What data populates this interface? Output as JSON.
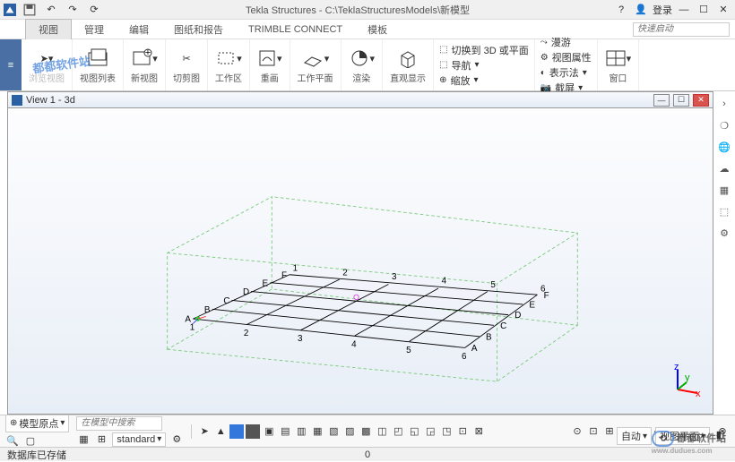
{
  "titlebar": {
    "appTitle": "Tekla Structures - C:\\TeklaStructuresModels\\新模型",
    "login": "登录"
  },
  "menu": {
    "tabs": [
      "视图",
      "管理",
      "编辑",
      "图纸和报告",
      "TRIMBLE CONNECT",
      "模板"
    ],
    "activeIndex": 0,
    "searchPlaceholder": "快速启动"
  },
  "ribbon": {
    "groups": [
      {
        "label": "浏览视图",
        "disabled": true
      },
      {
        "label": "视图列表"
      },
      {
        "label": "新视图"
      },
      {
        "label": "切剪图"
      },
      {
        "label": "工作区"
      },
      {
        "label": "重画"
      },
      {
        "label": "工作平面"
      },
      {
        "label": "渲染"
      },
      {
        "label": "直观显示"
      }
    ],
    "stack1": [
      "切换到 3D 或平面",
      "导航",
      "缩放"
    ],
    "stack2": [
      "漫游",
      "视图属性",
      "表示法",
      "截屏"
    ],
    "window": "窗口"
  },
  "view": {
    "title": "View 1 - 3d"
  },
  "grid": {
    "rows": [
      "A",
      "B",
      "C",
      "D",
      "E",
      "F"
    ],
    "cols": [
      "1",
      "2",
      "3",
      "4",
      "5",
      "6"
    ]
  },
  "bottom": {
    "originLabel": "模型原点",
    "searchPlaceholder": "在模型中搜索",
    "standard": "standard",
    "auto": "自动",
    "plane": "视图平面"
  },
  "status": {
    "msg": "数据库已存储",
    "center": "0"
  },
  "watermark": {
    "text1": "都都软件站",
    "text2": "都都软件站",
    "url": "www.dudues.com"
  }
}
